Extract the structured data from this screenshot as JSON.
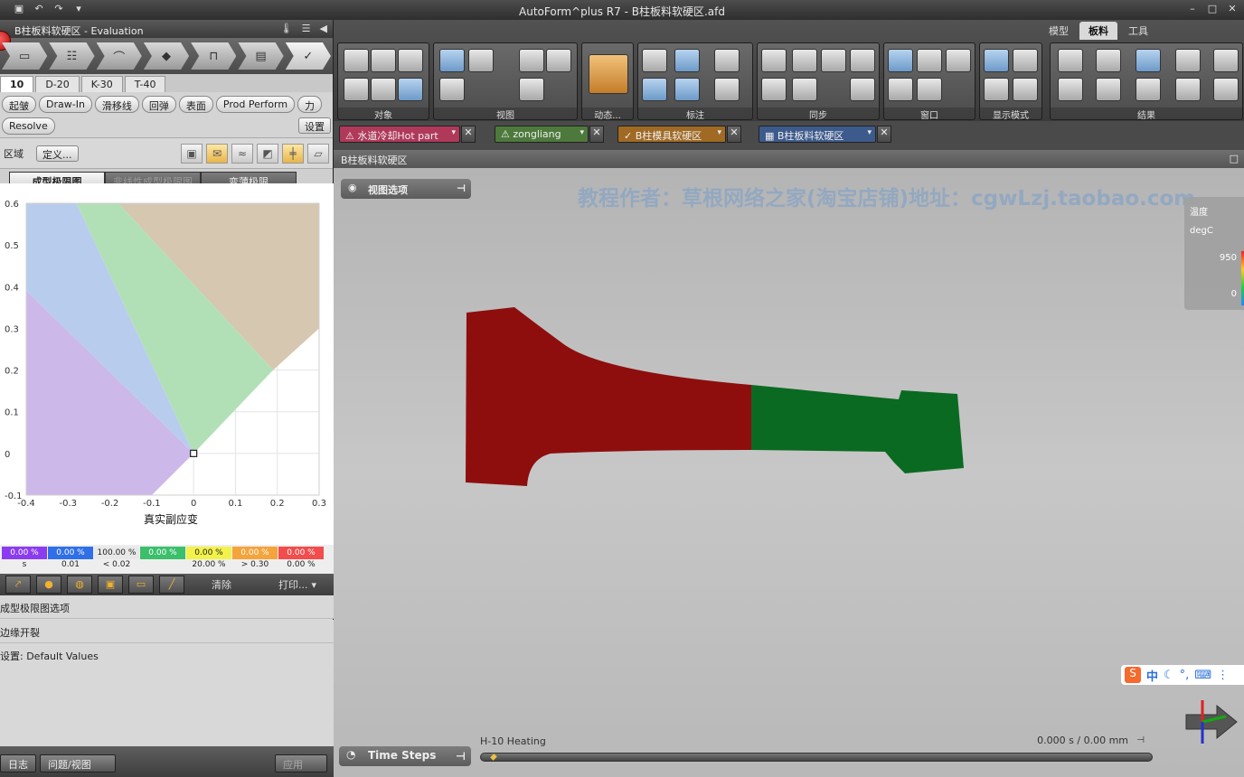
{
  "window": {
    "title": "AutoForm^plus R7 - B柱板料软硬区.afd"
  },
  "panel": {
    "title": "B柱板料软硬区 - Evaluation",
    "tabs": [
      "10",
      "D-20",
      "K-30",
      "T-40"
    ],
    "chips_row1": [
      "起皱",
      "Draw-In",
      "滑移线",
      "回弹",
      "表面",
      "Prod Perform",
      "力"
    ],
    "chips_row2_left": "Resolve",
    "settings_button": "设置",
    "region_label": "区域",
    "define_button": "定义...",
    "subtabs": [
      "成型极限图",
      "非线性成型极限图",
      "变薄极限"
    ],
    "toolbar": {
      "clear": "清除",
      "print": "打印..."
    },
    "sections": {
      "fld_options": "成型极限图选项",
      "edge_crack": "边缘开裂",
      "settings": "设置:  Default Values"
    },
    "footer": {
      "log": "日志",
      "issue_view": "问题/视图",
      "apply": "应用"
    }
  },
  "chart_data": {
    "type": "scatter",
    "xlabel": "真实副应变",
    "ylabel": "",
    "xlim": [
      -0.4,
      0.3
    ],
    "ylim": [
      -0.1,
      0.6
    ],
    "x_ticks": [
      "-0.4",
      "-0.3",
      "-0.2",
      "-0.1",
      "0",
      "0.1",
      "0.2",
      "0.3"
    ],
    "y_ticks": [
      "0.6",
      "0.5",
      "0.4",
      "0.3",
      "0.2",
      "0.1",
      "0",
      "-0.1"
    ],
    "points": [
      {
        "x": 0.0,
        "y": 0.0
      }
    ],
    "grid": true,
    "regions": [
      {
        "color": "#d6c7b1"
      },
      {
        "color": "#b2e0b6"
      },
      {
        "color": "#b8cdee"
      },
      {
        "color": "#cdb8ea"
      }
    ],
    "legend": [
      {
        "value": "0.00 %",
        "label": "s",
        "color": "#8b3cf0"
      },
      {
        "value": "0.00 %",
        "label": "0.01",
        "color": "#2f6fe8"
      },
      {
        "value": "100.00 %",
        "label": "< 0.02",
        "color": "#e8e8e8"
      },
      {
        "value": "0.00 %",
        "label": "",
        "color": "#3bbf6b"
      },
      {
        "value": "0.00 %",
        "label": "20.00 %",
        "color": "#f2f24a"
      },
      {
        "value": "0.00 %",
        "label": "> 0.30",
        "color": "#f5a33b"
      },
      {
        "value": "0.00 %",
        "label": "0.00 %",
        "color": "#f24c4c"
      }
    ]
  },
  "ribbon": {
    "tabs": [
      "模型",
      "板料",
      "工具"
    ],
    "groups": [
      "对象",
      "视图",
      "动态...",
      "标注",
      "同步",
      "窗口",
      "显示模式",
      "结果"
    ]
  },
  "doc_tabs": [
    {
      "label": "水道冷却Hot part",
      "color": "#b0395a"
    },
    {
      "label": "zongliang",
      "color": "#4d7a3c"
    },
    {
      "label": "B柱模具软硬区",
      "color": "#a06a24"
    },
    {
      "label": "B柱板料软硬区",
      "color": "#3d5a8c"
    }
  ],
  "viewport": {
    "header": "B柱板料软硬区",
    "view_options": "视图选项",
    "watermark": "教程作者：草根网络之家(淘宝店铺)地址：cgwLzj.taobao.com",
    "legend_title": "温度",
    "legend_unit": "degC",
    "legend_max": "950",
    "legend_min": "0",
    "hard_color": "#8e0e0e",
    "soft_color": "#0a6a22",
    "time_steps": "Time Steps",
    "step_name": "H-10 Heating",
    "step_time": "0.000 s / 0.00 mm",
    "ime_label": "中"
  }
}
